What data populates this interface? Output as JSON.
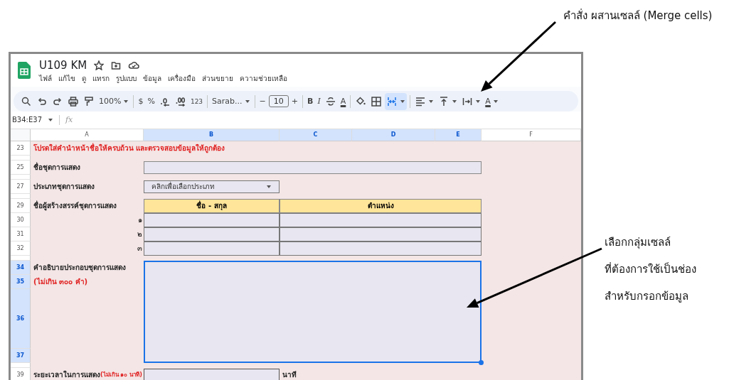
{
  "annotations": [
    {
      "text": "คำสั่ง ผสานเซลล์ (Merge cells)"
    },
    {
      "lines": [
        "เลือกกลุ่มเซลล์",
        "ที่ต้องการใช้เป็นช่อง",
        "สำหรับกรอกข้อมูล"
      ]
    }
  ],
  "document": {
    "title": "U109 KM"
  },
  "menu": [
    "ไฟล์",
    "แก้ไข",
    "ดู",
    "แทรก",
    "รูปแบบ",
    "ข้อมูล",
    "เครื่องมือ",
    "ส่วนขยาย",
    "ความช่วยเหลือ"
  ],
  "toolbar": [
    {
      "kind": "icon",
      "selected": false
    },
    {
      "kind": "icon",
      "selected": false
    },
    {
      "kind": "icon",
      "selected": false
    },
    {
      "kind": "icon",
      "selected": false
    },
    {
      "kind": "icon",
      "selected": false
    },
    {
      "kind": "text",
      "label": "100%",
      "dropdown": true,
      "selected": false
    },
    {
      "kind": "sep"
    },
    {
      "kind": "text",
      "label": "$",
      "selected": false
    },
    {
      "kind": "text",
      "label": "%",
      "selected": false
    },
    {
      "kind": "icon",
      "selected": false
    },
    {
      "kind": "icon",
      "selected": false
    },
    {
      "kind": "small",
      "label": "123",
      "selected": false
    },
    {
      "kind": "sep"
    },
    {
      "kind": "text",
      "label": "Sarab...",
      "dropdown": true,
      "selected": false
    },
    {
      "kind": "sep"
    },
    {
      "kind": "text",
      "label": "−",
      "selected": false
    },
    {
      "kind": "field",
      "label": "10"
    },
    {
      "kind": "text",
      "label": "+",
      "selected": false
    },
    {
      "kind": "sep"
    },
    {
      "kind": "bold",
      "label": "B",
      "selected": false
    },
    {
      "kind": "italic",
      "label": "I",
      "selected": false
    },
    {
      "kind": "icon",
      "selected": false
    },
    {
      "kind": "color",
      "label": "A",
      "selected": false
    },
    {
      "kind": "sep"
    },
    {
      "kind": "icon",
      "selected": false
    },
    {
      "kind": "icon",
      "selected": false
    },
    {
      "kind": "icon",
      "selected": true,
      "dropdown": true
    },
    {
      "kind": "sep"
    },
    {
      "kind": "icon",
      "selected": false,
      "dropdown": true
    },
    {
      "kind": "icon",
      "selected": false,
      "dropdown": true
    },
    {
      "kind": "icon",
      "selected": false,
      "dropdown": true
    },
    {
      "kind": "color",
      "label": "A",
      "selected": false,
      "dropdown": true
    }
  ],
  "formula_bar": {
    "name_box": "B34:E37",
    "function_label": "fx"
  },
  "columns": [
    {
      "label": "A",
      "selected": false
    },
    {
      "label": "B",
      "selected": true
    },
    {
      "label": "C",
      "selected": true
    },
    {
      "label": "D",
      "selected": true
    },
    {
      "label": "E",
      "selected": true
    },
    {
      "label": "F",
      "selected": false
    }
  ],
  "rows": [
    {
      "label": "23",
      "kind": "normal",
      "selected": false
    },
    {
      "kind": "thin",
      "selected": false
    },
    {
      "label": "25",
      "kind": "normal",
      "selected": false
    },
    {
      "kind": "thin",
      "selected": false
    },
    {
      "label": "27",
      "kind": "normal",
      "selected": false
    },
    {
      "kind": "thin",
      "selected": false
    },
    {
      "label": "29",
      "kind": "normal",
      "selected": false
    },
    {
      "label": "30",
      "kind": "normal",
      "selected": false
    },
    {
      "label": "31",
      "kind": "normal",
      "selected": false
    },
    {
      "label": "32",
      "kind": "normal",
      "selected": false
    },
    {
      "kind": "thin",
      "selected": false
    },
    {
      "label": "34",
      "kind": "normal",
      "selected": true
    },
    {
      "label": "35",
      "kind": "normal",
      "selected": true
    },
    {
      "label": "36",
      "kind": "tall",
      "selected": true
    },
    {
      "label": "37",
      "kind": "normal",
      "selected": true
    },
    {
      "kind": "thin",
      "selected": false
    },
    {
      "label": "39",
      "kind": "normal",
      "selected": false
    }
  ],
  "form": {
    "notice": "โปรดใส่คำนำหน้าชื่อให้ครบถ้วน และตรวจสอบข้อมูลให้ถูกต้อง",
    "title_field": {
      "label": "ชื่อชุดการแสดง"
    },
    "type_field": {
      "label": "ประเภทชุดการแสดง",
      "value": "คลิกเพื่อเลือกประเภท"
    },
    "creators": {
      "label": "ชื่อผู้สร้างสรรค์ชุดการแสดง",
      "columns": [
        "ชื่อ - สกุล",
        "ตำแหน่ง"
      ],
      "rows": [
        {
          "number": "๑"
        },
        {
          "number": "๒"
        },
        {
          "number": "๓"
        }
      ]
    },
    "description": {
      "label": "คำอธิบายประกอบชุดการแสดง",
      "note": "(ไม่เกิน ๓๐๐ คำ)",
      "selected": true
    },
    "duration": {
      "label": "ระยะเวลาในการแสดง",
      "note": "(ไม่เกิน ๑๐ นาที)",
      "unit": "นาที"
    }
  }
}
